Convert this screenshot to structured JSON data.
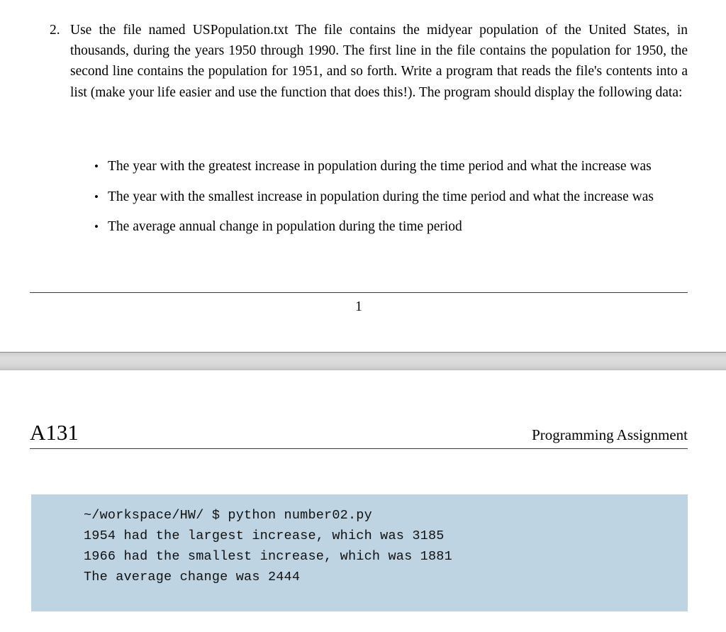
{
  "page_one": {
    "exercise": {
      "marker": "2.",
      "text": "Use the file named USPopulation.txt The file contains the midyear population of the United States, in thousands, during the years 1950 through 1990. The first line in the file contains the population for 1950, the second line contains the population for 1951, and so forth. Write a program that reads the file's contents into a list (make your life easier and use the function that does this!). The program should display the following data:"
    },
    "bullets": [
      {
        "marker": "•",
        "text": "The year with the greatest increase in population during the time period and what the increase was"
      },
      {
        "marker": "•",
        "text": "The year with the smallest increase in population during the time period and what the increase was"
      },
      {
        "marker": "•",
        "text": "The average annual change in population during the time period"
      }
    ],
    "page_number": "1"
  },
  "page_two": {
    "header": {
      "course_code": "A131",
      "assignment_title": "Programming Assignment"
    },
    "terminal": {
      "background_color": "#bed4e3",
      "lines": [
        "~/workspace/HW/ $ python number02.py",
        "1954 had the largest increase, which was 3185",
        "1966 had the smallest increase, which was 1881",
        "The average change was 2444"
      ]
    }
  }
}
